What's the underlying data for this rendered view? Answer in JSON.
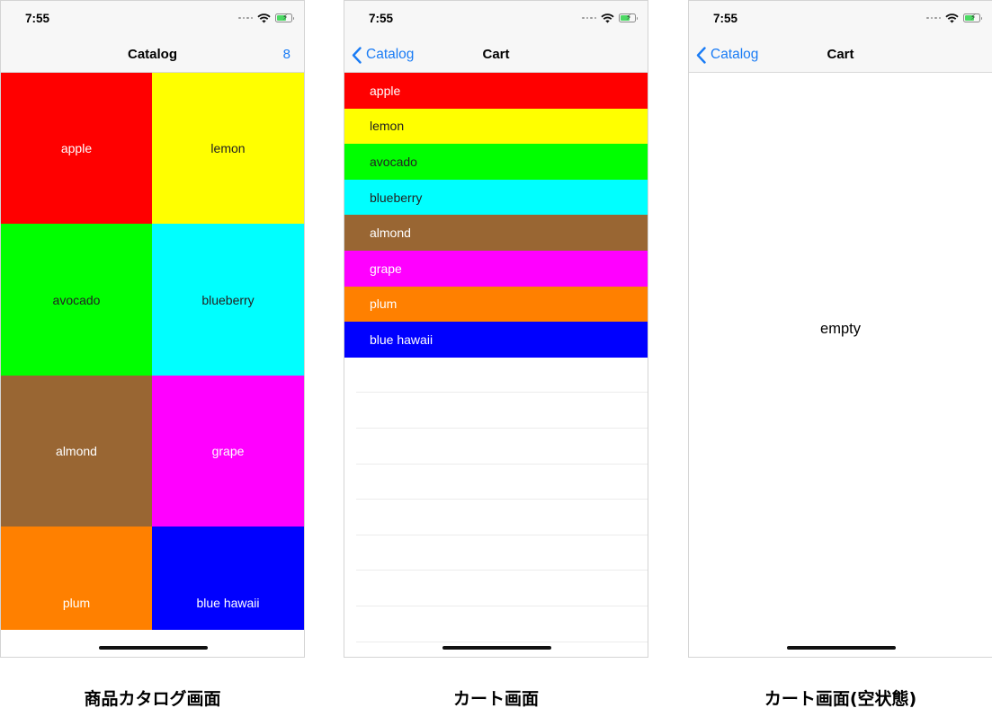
{
  "screens": {
    "catalog": {
      "status_time": "7:55",
      "nav_title": "Catalog",
      "nav_right": "8",
      "items": [
        {
          "label": "apple",
          "color": "#ff0000",
          "text_color": "#ffffff"
        },
        {
          "label": "lemon",
          "color": "#ffff00",
          "text_color": "#222222"
        },
        {
          "label": "avocado",
          "color": "#00ff00",
          "text_color": "#222222"
        },
        {
          "label": "blueberry",
          "color": "#00ffff",
          "text_color": "#222222"
        },
        {
          "label": "almond",
          "color": "#996633",
          "text_color": "#ffffff"
        },
        {
          "label": "grape",
          "color": "#ff00ff",
          "text_color": "#ffffff"
        },
        {
          "label": "plum",
          "color": "#ff8000",
          "text_color": "#ffffff"
        },
        {
          "label": "blue hawaii",
          "color": "#0000ff",
          "text_color": "#ffffff"
        }
      ],
      "caption": "商品カタログ画面"
    },
    "cart": {
      "status_time": "7:55",
      "back_label": "Catalog",
      "nav_title": "Cart",
      "items": [
        {
          "label": "apple",
          "color": "#ff0000",
          "text_color": "#ffffff"
        },
        {
          "label": "lemon",
          "color": "#ffff00",
          "text_color": "#222222"
        },
        {
          "label": "avocado",
          "color": "#00ff00",
          "text_color": "#222222"
        },
        {
          "label": "blueberry",
          "color": "#00ffff",
          "text_color": "#222222"
        },
        {
          "label": "almond",
          "color": "#996633",
          "text_color": "#ffffff"
        },
        {
          "label": "grape",
          "color": "#ff00ff",
          "text_color": "#ffffff"
        },
        {
          "label": "plum",
          "color": "#ff8000",
          "text_color": "#ffffff"
        },
        {
          "label": "blue hawaii",
          "color": "#0000ff",
          "text_color": "#ffffff"
        }
      ],
      "caption": "カート画面"
    },
    "cart_empty": {
      "status_time": "7:55",
      "back_label": "Catalog",
      "nav_title": "Cart",
      "empty_label": "empty",
      "caption": "カート画面(空状態)"
    }
  },
  "icons": [
    "signal-icon",
    "wifi-icon",
    "battery-icon",
    "chevron-left-icon"
  ],
  "accent_color": "#1a7cf5"
}
